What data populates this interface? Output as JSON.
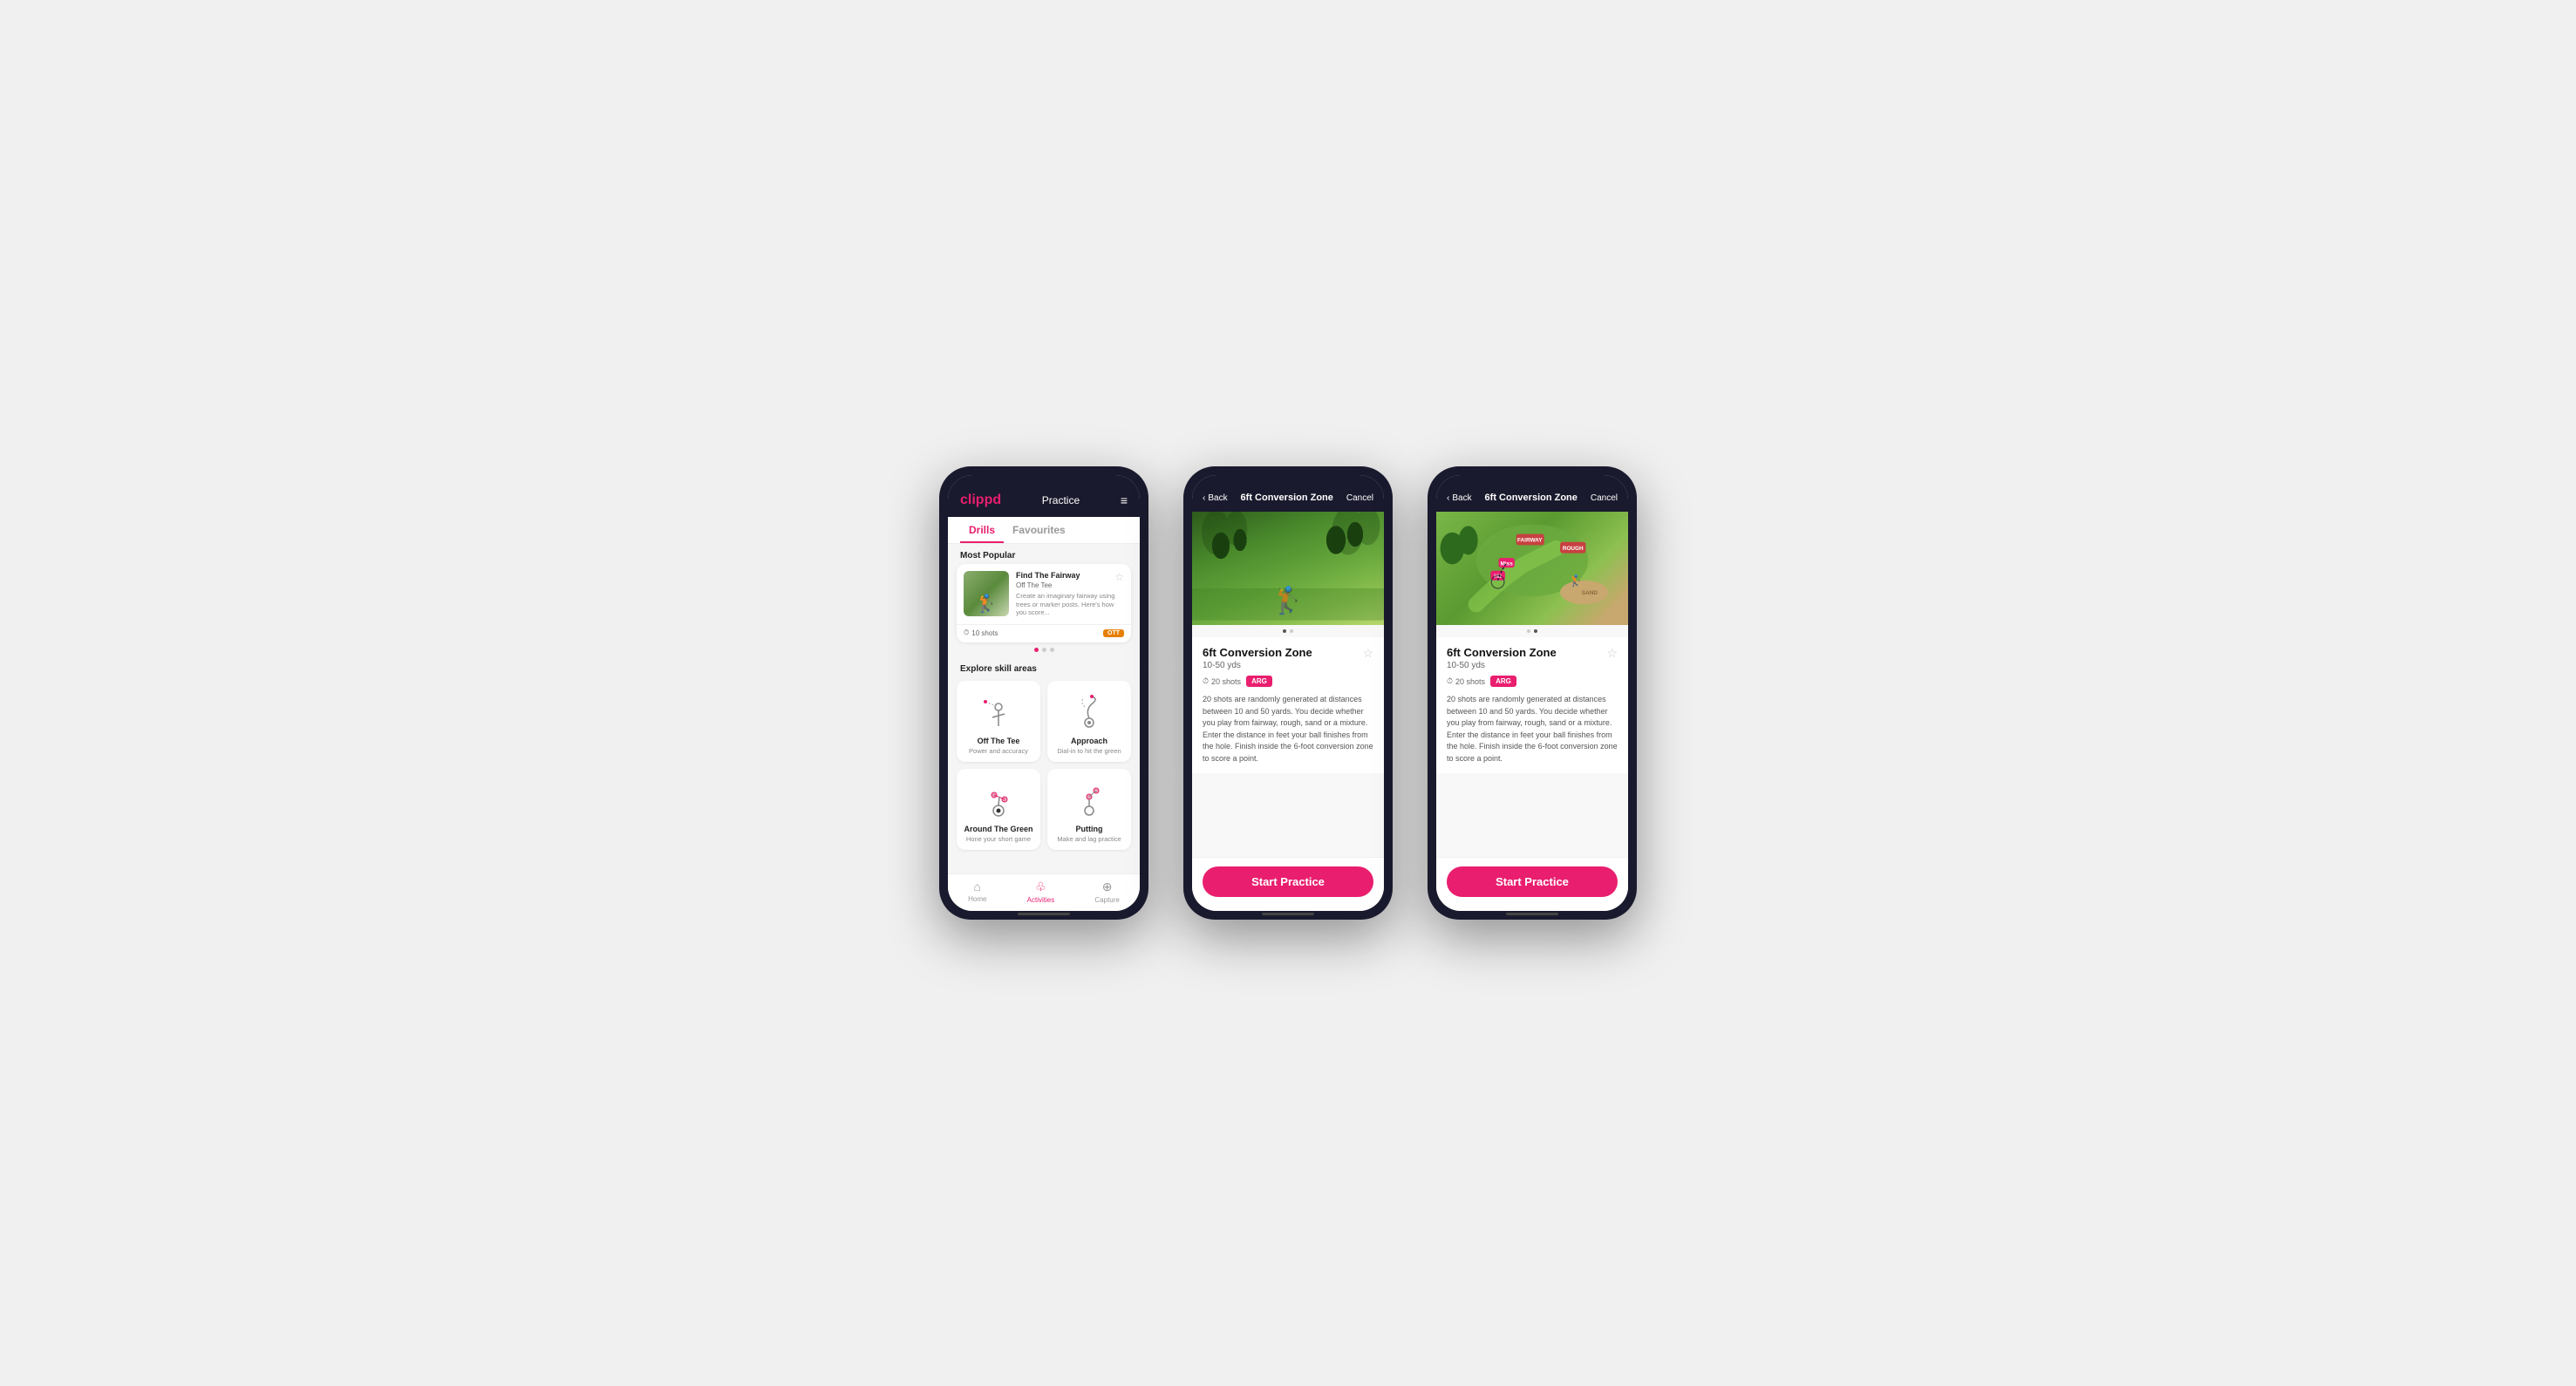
{
  "phone1": {
    "header": {
      "logo": "clippd",
      "title": "Practice",
      "menu_icon": "≡"
    },
    "tabs": [
      {
        "label": "Drills",
        "active": true
      },
      {
        "label": "Favourites",
        "active": false
      }
    ],
    "most_popular_label": "Most Popular",
    "drill_card": {
      "title": "Find The Fairway",
      "subtitle": "Off The Tee",
      "desc": "Create an imaginary fairway using trees or marker posts. Here's how you score...",
      "shots": "10 shots",
      "tag": "OTT",
      "fav_icon": "☆"
    },
    "explore_label": "Explore skill areas",
    "skill_areas": [
      {
        "name": "Off The Tee",
        "desc": "Power and accuracy",
        "key": "off-tee"
      },
      {
        "name": "Approach",
        "desc": "Dial-in to hit the green",
        "key": "approach"
      },
      {
        "name": "Around The Green",
        "desc": "Hone your short game",
        "key": "around-green"
      },
      {
        "name": "Putting",
        "desc": "Make and lag practice",
        "key": "putting"
      }
    ],
    "bottom_nav": [
      {
        "label": "Home",
        "icon": "⌂",
        "active": false
      },
      {
        "label": "Activities",
        "icon": "♧",
        "active": true
      },
      {
        "label": "Capture",
        "icon": "⊕",
        "active": false
      }
    ]
  },
  "phone2": {
    "header": {
      "back": "Back",
      "title": "6ft Conversion Zone",
      "cancel": "Cancel"
    },
    "drill": {
      "title": "6ft Conversion Zone",
      "range": "10-50 yds",
      "shots": "20 shots",
      "tag": "ARG",
      "fav_icon": "☆",
      "description": "20 shots are randomly generated at distances between 10 and 50 yards. You decide whether you play from fairway, rough, sand or a mixture. Enter the distance in feet your ball finishes from the hole. Finish inside the 6-foot conversion zone to score a point.",
      "start_btn": "Start Practice"
    }
  },
  "phone3": {
    "header": {
      "back": "Back",
      "title": "6ft Conversion Zone",
      "cancel": "Cancel"
    },
    "drill": {
      "title": "6ft Conversion Zone",
      "range": "10-50 yds",
      "shots": "20 shots",
      "tag": "ARG",
      "fav_icon": "☆",
      "description": "20 shots are randomly generated at distances between 10 and 50 yards. You decide whether you play from fairway, rough, sand or a mixture. Enter the distance in feet your ball finishes from the hole. Finish inside the 6-foot conversion zone to score a point.",
      "start_btn": "Start Practice"
    }
  }
}
